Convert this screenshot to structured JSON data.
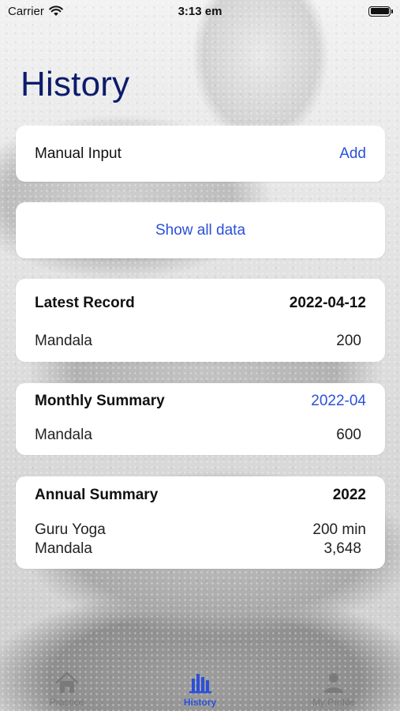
{
  "status_bar": {
    "carrier": "Carrier",
    "time": "3:13 em"
  },
  "page": {
    "title": "History"
  },
  "manual_input": {
    "label": "Manual Input",
    "action": "Add"
  },
  "show_all": {
    "label": "Show all data"
  },
  "latest_record": {
    "title": "Latest Record",
    "date": "2022-04-12",
    "item": "Mandala",
    "value": "200"
  },
  "monthly_summary": {
    "title": "Monthly Summary",
    "period": "2022-04",
    "item": "Mandala",
    "value": "600"
  },
  "annual_summary": {
    "title": "Annual Summary",
    "year": "2022",
    "rows": [
      {
        "item": "Guru Yoga",
        "value": "200 min"
      },
      {
        "item": "Mandala",
        "value": "3,648"
      }
    ]
  },
  "tabs": [
    {
      "label": "Practice",
      "icon": "house-icon"
    },
    {
      "label": "History",
      "icon": "bar-chart-icon",
      "active": true
    },
    {
      "label": "My Profile",
      "icon": "person-icon"
    }
  ],
  "colors": {
    "accent": "#2b50d8",
    "title": "#0c1b6b"
  }
}
